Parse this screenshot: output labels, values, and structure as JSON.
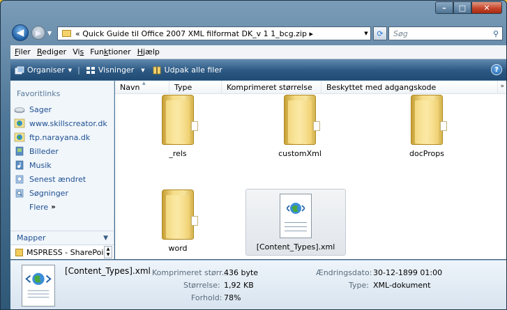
{
  "window": {
    "minimize": "–",
    "maximize": "□",
    "close": "✕"
  },
  "address": {
    "prefix": "«",
    "path": "Quick Guide til Office 2007 XML filformat DK_v 1 1_bcg.zip",
    "arrow": "▸",
    "search_placeholder": "Søg"
  },
  "menu": {
    "items": [
      "Filer",
      "Rediger",
      "Vis",
      "Funktioner",
      "Hjælp"
    ],
    "underline": [
      "F",
      "R",
      "s",
      "k",
      "H"
    ]
  },
  "toolbar": {
    "organize": "Organiser",
    "views": "Visninger",
    "extract": "Udpak alle filer",
    "help": "?"
  },
  "sidebar": {
    "header": "Favoritlinks",
    "links": [
      {
        "label": "Sager",
        "icon": "drive-icon"
      },
      {
        "label": "www.skillscreator.dk",
        "icon": "web-icon"
      },
      {
        "label": "ftp.narayana.dk",
        "icon": "web-icon"
      },
      {
        "label": "Billeder",
        "icon": "pictures-icon"
      },
      {
        "label": "Musik",
        "icon": "music-icon"
      },
      {
        "label": "Senest ændret",
        "icon": "recent-icon"
      },
      {
        "label": "Søgninger",
        "icon": "search-folder-icon"
      }
    ],
    "more": "Flere",
    "more_arrows": "»",
    "folders_header": "Mapper",
    "tree_item": "MSPRESS - SharePoint"
  },
  "columns": [
    {
      "label": "Navn"
    },
    {
      "label": "Type"
    },
    {
      "label": "Komprimeret størrelse"
    },
    {
      "label": "Beskyttet med adgangskode"
    }
  ],
  "col_more": "»",
  "items": [
    {
      "name": "_rels",
      "kind": "folder"
    },
    {
      "name": "customXml",
      "kind": "folder"
    },
    {
      "name": "docProps",
      "kind": "folder"
    },
    {
      "name": "word",
      "kind": "folder"
    },
    {
      "name": "[Content_Types].xml",
      "kind": "xml",
      "selected": true
    }
  ],
  "details": {
    "filename": "[Content_Types].xml",
    "compressed_label": "Komprimeret størr...",
    "compressed_value": "436 byte",
    "size_label": "Størrelse:",
    "size_value": "1,92 KB",
    "ratio_label": "Forhold:",
    "ratio_value": "78%",
    "modified_label": "Ændringsdato:",
    "modified_value": "30-12-1899 01:00",
    "type_label": "Type:",
    "type_value": "XML-dokument"
  },
  "colors": {
    "accent": "#2d5a84",
    "link": "#1d4f91",
    "desktop": "#f2c22a"
  }
}
